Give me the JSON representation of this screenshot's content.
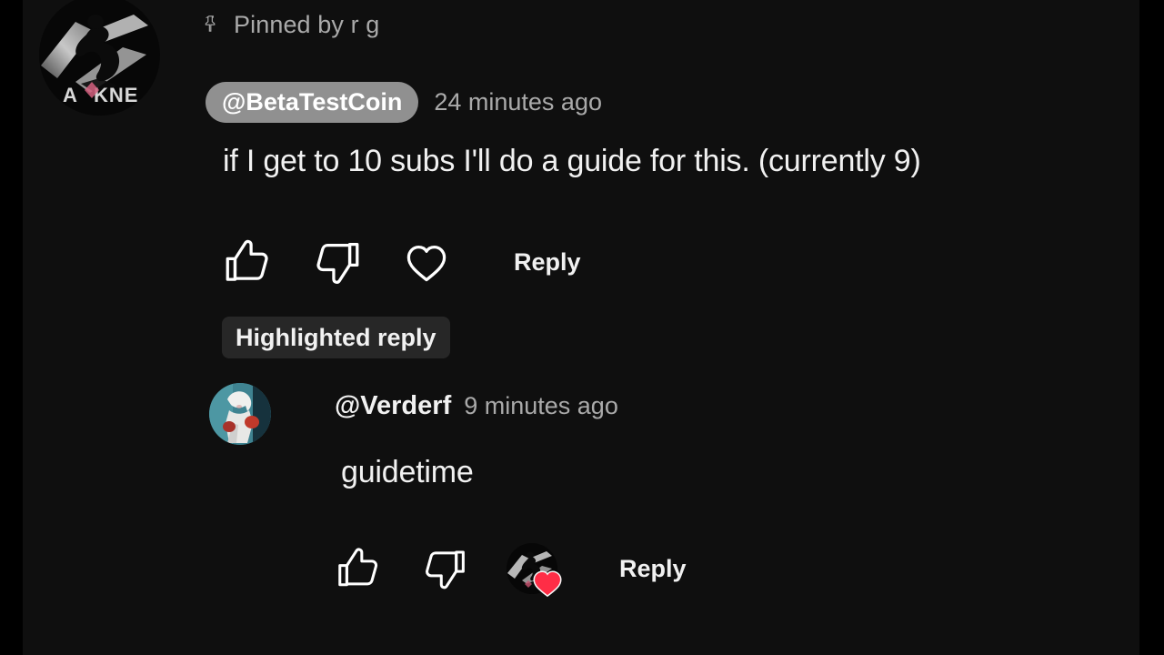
{
  "theme": {
    "page_bg": "#0f0f0f",
    "letterbox": "#000000",
    "text_primary": "#f1f1f1",
    "text_secondary": "#aaaaaa",
    "chip_bg": "#909090",
    "badge_bg": "#272727",
    "heart_red": "#ff2d46"
  },
  "pinned": {
    "icon": "pin-icon",
    "label": "Pinned by r g"
  },
  "comment": {
    "avatar_icon": "channel-avatar",
    "author_handle": "@BetaTestCoin",
    "timestamp": "24 minutes ago",
    "body": "if I get to 10 subs I'll do a guide for this. (currently 9)",
    "actions": {
      "like_icon": "thumbs-up-icon",
      "dislike_icon": "thumbs-down-icon",
      "heart_icon": "heart-outline-icon",
      "reply_label": "Reply"
    }
  },
  "reply_section": {
    "highlight_badge": "Highlighted reply",
    "reply": {
      "avatar_icon": "commenter-avatar",
      "author_handle": "@Verderf",
      "timestamp": "9 minutes ago",
      "body": "guidetime",
      "actions": {
        "like_icon": "thumbs-up-icon",
        "dislike_icon": "thumbs-down-icon",
        "creator_heart_icon": "creator-heart-badge",
        "reply_label": "Reply"
      }
    }
  }
}
